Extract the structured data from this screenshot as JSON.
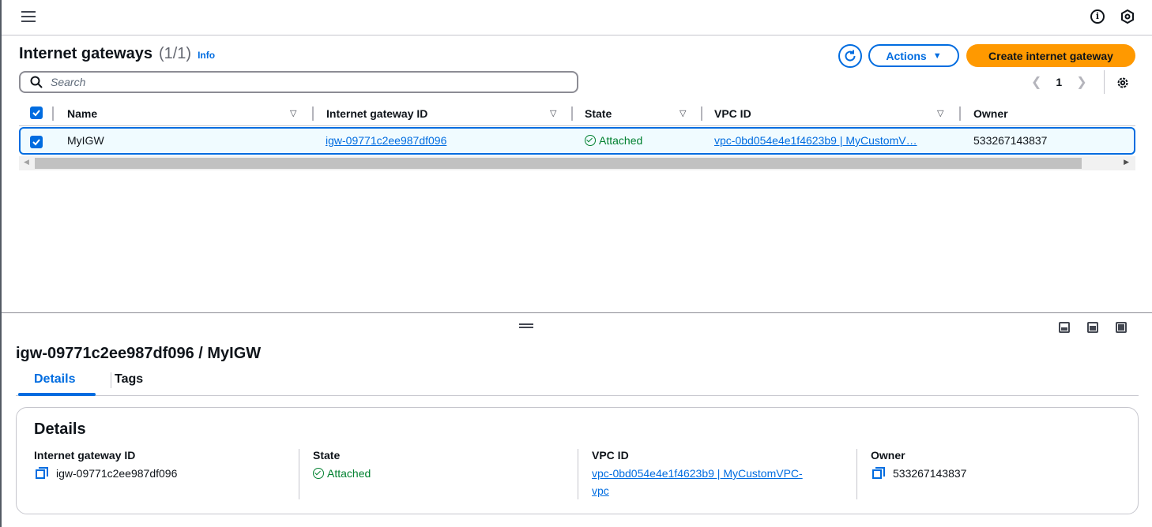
{
  "list": {
    "title": "Internet gateways",
    "count": "(1/1)",
    "info": "Info",
    "actions_label": "Actions",
    "create_label": "Create internet gateway",
    "search_placeholder": "Search",
    "page": "1",
    "columns": [
      "Name",
      "Internet gateway ID",
      "State",
      "VPC ID",
      "Owner"
    ],
    "rows": [
      {
        "name": "MyIGW",
        "igw_id": "igw-09771c2ee987df096",
        "state": "Attached",
        "vpc_id": "vpc-0bd054e4e1f4623b9 | MyCustomV…",
        "owner": "533267143837"
      }
    ]
  },
  "detail": {
    "title": "igw-09771c2ee987df096 / MyIGW",
    "tabs": [
      "Details",
      "Tags"
    ],
    "card_title": "Details",
    "fields": {
      "igw_label": "Internet gateway ID",
      "igw_value": "igw-09771c2ee987df096",
      "state_label": "State",
      "state_value": "Attached",
      "vpc_label": "VPC ID",
      "vpc_value_line1": "vpc-0bd054e4e1f4623b9 | MyCustomVPC-",
      "vpc_value_line2": "vpc",
      "owner_label": "Owner",
      "owner_value": "533267143837"
    }
  },
  "colors": {
    "accent": "#006ce0",
    "primary_button": "#ff9900",
    "success": "#00802f"
  }
}
